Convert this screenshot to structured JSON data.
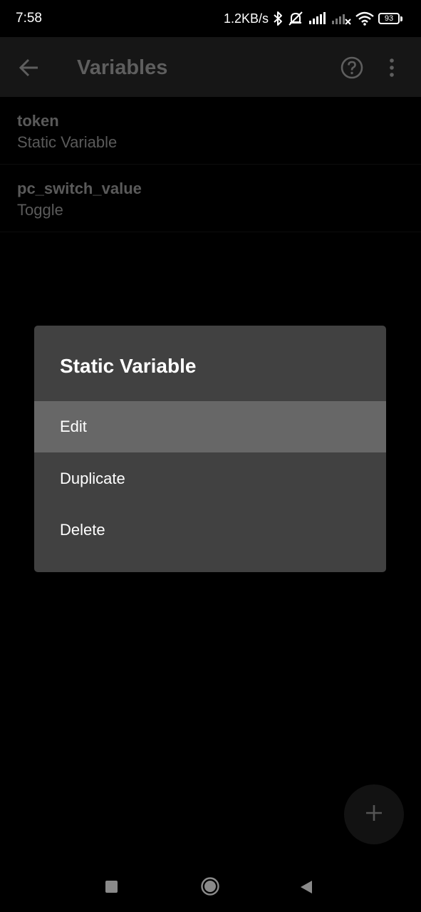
{
  "status_bar": {
    "time": "7:58",
    "net_speed": "1.2KB/s",
    "battery_level": "93",
    "icons": [
      "bluetooth-icon",
      "mute-vibrate-icon",
      "signal-icon",
      "signal-no-service-icon",
      "wifi-icon",
      "battery-icon"
    ]
  },
  "app_bar": {
    "title": "Variables",
    "icons": [
      "back-arrow-icon",
      "help-icon",
      "overflow-menu-icon"
    ]
  },
  "variables": [
    {
      "name": "token",
      "type": "Static Variable"
    },
    {
      "name": "pc_switch_value",
      "type": "Toggle"
    }
  ],
  "dialog": {
    "title": "Static Variable",
    "items": [
      {
        "label": "Edit",
        "highlighted": true
      },
      {
        "label": "Duplicate",
        "highlighted": false
      },
      {
        "label": "Delete",
        "highlighted": false
      }
    ]
  },
  "fab": {
    "icon": "plus-icon"
  },
  "nav_bar": {
    "icons": [
      "recent-apps-icon",
      "home-icon",
      "back-icon"
    ]
  },
  "colors": {
    "background": "#000000",
    "app_bar": "#161616",
    "dimmed_text": "#5a5a5a",
    "dialog_bg": "#414141",
    "dialog_highlight": "#676767",
    "fab_bg": "#121212"
  }
}
